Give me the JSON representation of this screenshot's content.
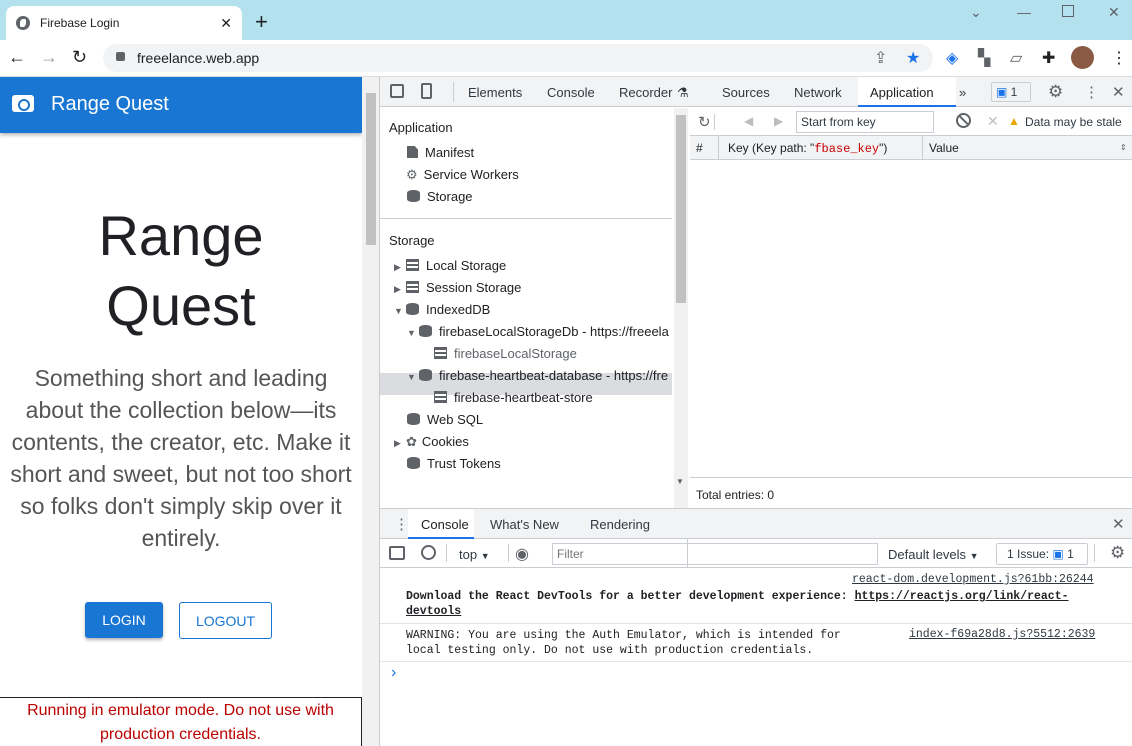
{
  "browser": {
    "tab_title": "Firebase Login",
    "url": "freeelance.web.app",
    "new_tab": "+",
    "close_tab": "✕"
  },
  "page": {
    "app_title": "Range Quest",
    "hero_line1": "Range",
    "hero_line2": "Quest",
    "blurb": "Something short and leading about the collection below—its contents, the creator, etc. Make it short and sweet, but not too short so folks don't simply skip over it entirely.",
    "login_label": "LOGIN",
    "logout_label": "LOGOUT",
    "emulator_warning": "Running in emulator mode. Do not use with production credentials."
  },
  "devtools": {
    "tabs": [
      "Elements",
      "Console",
      "Recorder",
      "Sources",
      "Network",
      "Application"
    ],
    "active_tab": "Application",
    "issues_badge": "1",
    "sidebar": {
      "application_header": "Application",
      "application_items": [
        "Manifest",
        "Service Workers",
        "Storage"
      ],
      "storage_header": "Storage",
      "storage_items": {
        "local_storage": "Local Storage",
        "session_storage": "Session Storage",
        "indexeddb": "IndexedDB",
        "db1": "firebaseLocalStorageDb - https://freeela",
        "db1_store": "firebaseLocalStorage",
        "db2": "firebase-heartbeat-database - https://fre",
        "db2_store": "firebase-heartbeat-store",
        "web_sql": "Web SQL",
        "cookies": "Cookies",
        "trust_tokens": "Trust Tokens"
      }
    },
    "key_toolbar": {
      "start_from_key": "Start from key",
      "stale_warning": "Data may be stale"
    },
    "table": {
      "col_num": "#",
      "col_key_prefix": "Key (Key path: \"",
      "col_key_path": "fbase_key",
      "col_key_suffix": "\")",
      "col_value": "Value"
    },
    "total_entries": "Total entries: 0",
    "drawer": {
      "tabs": [
        "Console",
        "What's New",
        "Rendering"
      ],
      "context": "top",
      "filter_placeholder": "Filter",
      "levels": "Default levels",
      "issues_label": "1 Issue:",
      "issues_count": "1",
      "messages": [
        {
          "source": "react-dom.development.js?61bb:26244",
          "text": "Download the React DevTools for a better development experience: ",
          "link": "https://reactjs.org/link/react-devtools"
        },
        {
          "source": "index-f69a28d8.js?5512:2639",
          "text": "WARNING: You are using the Auth Emulator, which is intended for local testing only.  Do not use with production credentials."
        }
      ],
      "prompt": "›"
    }
  },
  "colors": {
    "appbar": "#1976d2",
    "titlebar": "#b4e1ee",
    "warning_text": "#bb0000",
    "accent": "#1a73e8"
  }
}
